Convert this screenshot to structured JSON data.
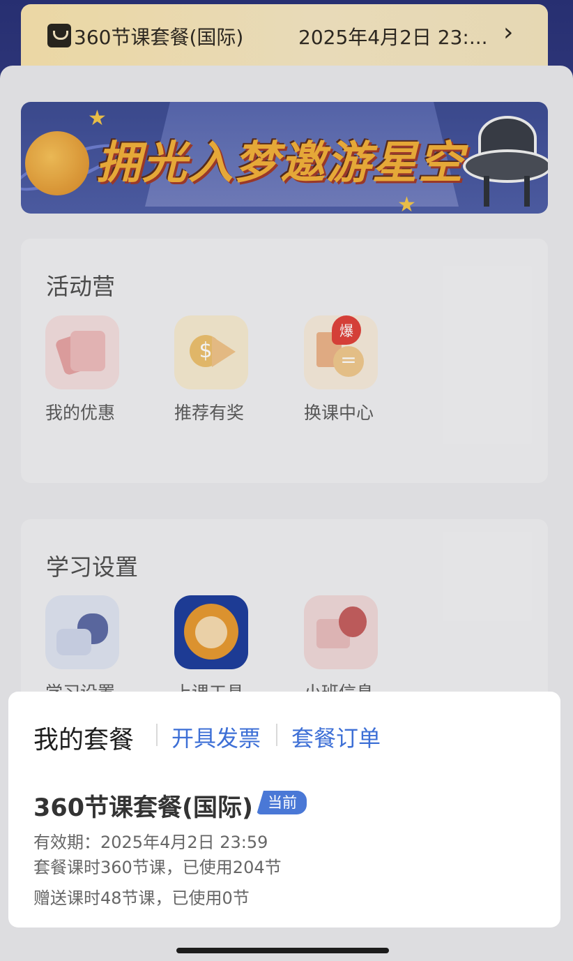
{
  "package_strip": {
    "name": "360节课套餐(国际)",
    "date": "2025年4月2日 23:...",
    "chevron": "›"
  },
  "banner": {
    "slogan": "拥光入梦邀游星空"
  },
  "activity": {
    "title": "活动营",
    "items": [
      {
        "label": "我的优惠",
        "icon": "coupon-icon"
      },
      {
        "label": "推荐有奖",
        "icon": "referral-reward-icon"
      },
      {
        "label": "换课中心",
        "icon": "course-swap-icon"
      }
    ],
    "hot_badge": "爆"
  },
  "study": {
    "title": "学习设置",
    "items": [
      {
        "label": "学习设置",
        "icon": "settings-gear-icon"
      },
      {
        "label": "上课工具",
        "icon": "lion-mascot-icon"
      },
      {
        "label": "小班信息",
        "icon": "class-info-icon"
      }
    ]
  },
  "sheet": {
    "tab_title": "我的套餐",
    "link_invoice": "开具发票",
    "link_orders": "套餐订单",
    "package_name": "360节课套餐(国际)",
    "current_badge": "当前",
    "validity": "有效期：2025年4月2日 23:59",
    "hours": "套餐课时360节课，已使用204节",
    "bonus": "赠送课时48节课，已使用0节"
  },
  "colors": {
    "link": "#3d6fd6",
    "badge": "#4a78d6",
    "hot": "#e0433c"
  }
}
